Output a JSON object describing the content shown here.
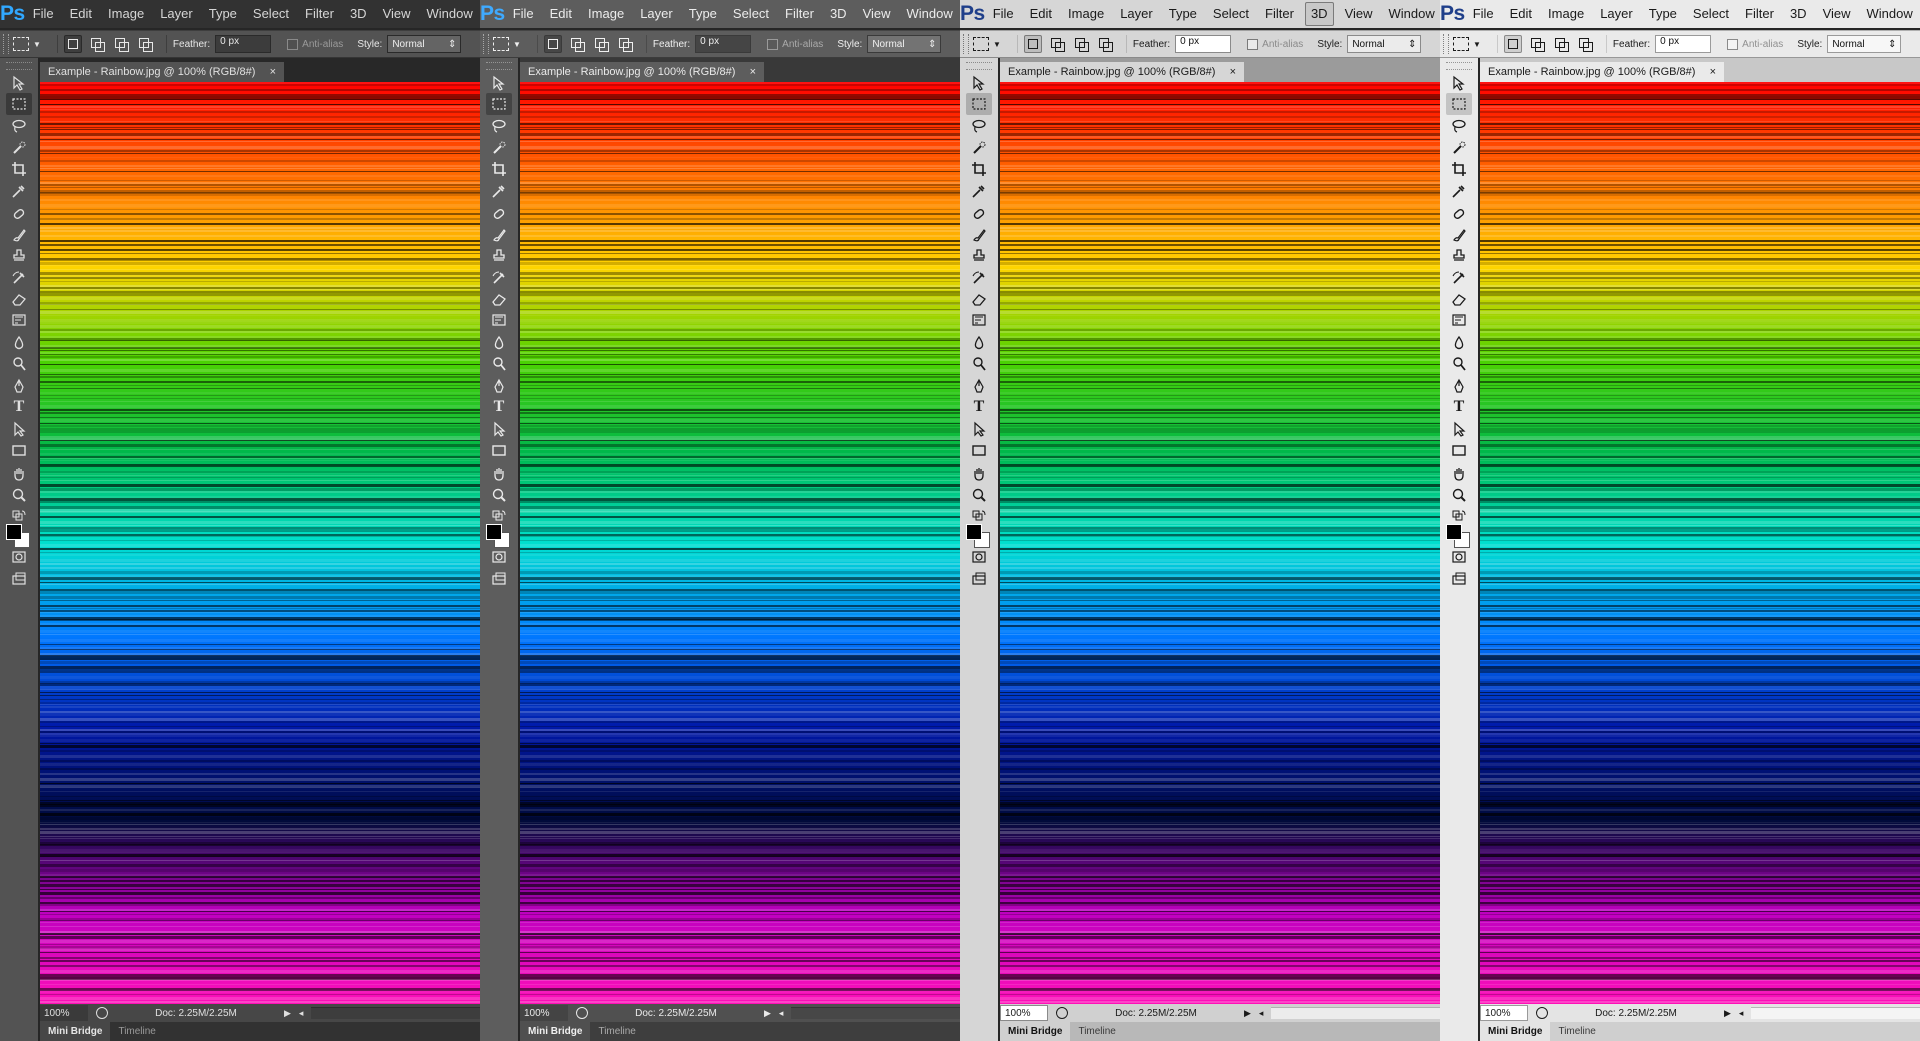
{
  "app_logo": "Ps",
  "menu": [
    "File",
    "Edit",
    "Image",
    "Layer",
    "Type",
    "Select",
    "Filter",
    "3D",
    "View",
    "Window"
  ],
  "options": {
    "feather_label": "Feather:",
    "feather_value": "0 px",
    "antialias_label": "Anti-alias",
    "style_label": "Style:",
    "style_value": "Normal"
  },
  "document": {
    "tab_title": "Example - Rainbow.jpg @ 100% (RGB/8#)",
    "zoom": "100%",
    "doc_info": "Doc: 2.25M/2.25M"
  },
  "bottom_tabs": [
    "Mini Bridge",
    "Timeline"
  ],
  "themes": [
    {
      "name": "dark",
      "active_menu": ""
    },
    {
      "name": "medium-dark",
      "active_menu": ""
    },
    {
      "name": "light",
      "active_menu": "3D"
    },
    {
      "name": "lightest",
      "active_menu": ""
    }
  ],
  "tools": [
    {
      "name": "move-tool-icon"
    },
    {
      "name": "rectangular-marquee-tool-icon",
      "selected": true
    },
    {
      "name": "lasso-tool-icon"
    },
    {
      "name": "quick-selection-tool-icon"
    },
    {
      "name": "crop-tool-icon"
    },
    {
      "name": "eyedropper-tool-icon"
    },
    {
      "name": "spot-healing-brush-icon"
    },
    {
      "name": "brush-tool-icon"
    },
    {
      "name": "clone-stamp-tool-icon"
    },
    {
      "name": "history-brush-icon"
    },
    {
      "name": "eraser-tool-icon"
    },
    {
      "name": "gradient-tool-icon"
    },
    {
      "name": "blur-tool-icon"
    },
    {
      "name": "dodge-tool-icon"
    },
    {
      "name": "pen-tool-icon"
    },
    {
      "name": "type-tool-icon"
    },
    {
      "name": "path-selection-tool-icon"
    },
    {
      "name": "rectangle-tool-icon"
    },
    {
      "name": "hand-tool-icon"
    },
    {
      "name": "zoom-tool-icon"
    },
    {
      "name": "default-colors-icon"
    },
    {
      "name": "quick-mask-icon"
    },
    {
      "name": "screen-mode-icon"
    }
  ],
  "colors": {
    "foreground": "#000000",
    "background": "#ffffff",
    "rainbow_bands": [
      "#ff0000",
      "#ff6a00",
      "#ffd400",
      "#4dd300",
      "#00b84a",
      "#00e0d0",
      "#0078ff",
      "#0018a8",
      "#000a3a",
      "#c000c0",
      "#ff10b8"
    ]
  }
}
